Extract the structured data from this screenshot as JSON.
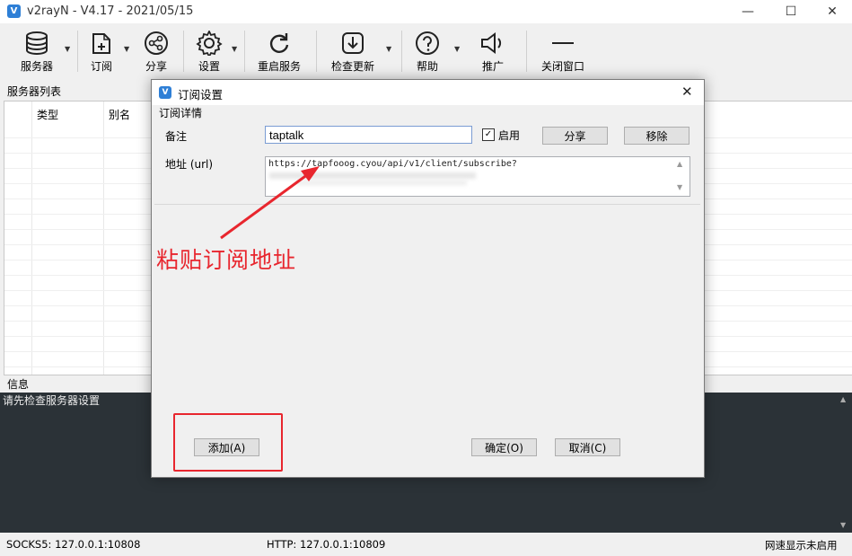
{
  "window": {
    "title": "v2rayN - V4.17 - 2021/05/15"
  },
  "toolbar": {
    "items": [
      {
        "label": "服务器",
        "icon": "server-database-icon"
      },
      {
        "label": "订阅",
        "icon": "subscription-icon"
      },
      {
        "label": "分享",
        "icon": "share-icon"
      },
      {
        "label": "设置",
        "icon": "gear-icon"
      },
      {
        "label": "重启服务",
        "icon": "restart-icon"
      },
      {
        "label": "检查更新",
        "icon": "download-update-icon"
      },
      {
        "label": "帮助",
        "icon": "help-icon"
      },
      {
        "label": "推广",
        "icon": "speaker-icon"
      },
      {
        "label": "关闭窗口",
        "icon": "minimize-line-icon"
      }
    ]
  },
  "server_list": {
    "title": "服务器列表",
    "columns": [
      "类型",
      "别名"
    ]
  },
  "info": {
    "title": "信息",
    "text": "请先检查服务器设置"
  },
  "status_bar": {
    "socks": "SOCKS5:  127.0.0.1:10808",
    "http": "HTTP:  127.0.0.1:10809",
    "speed": "网速显示未启用"
  },
  "dialog": {
    "title": "订阅设置",
    "group_title": "订阅详情",
    "remark_label": "备注",
    "remark_value": "taptalk",
    "enable_label": "启用",
    "enabled": true,
    "share_button": "分享",
    "remove_button": "移除",
    "url_label": "地址 (url)",
    "url_value": "https://tapfooog.cyou/api/v1/client/subscribe?",
    "add_button": "添加(A)",
    "ok_button": "确定(O)",
    "cancel_button": "取消(C)"
  },
  "annotation": {
    "text": "粘贴订阅地址",
    "color": "#e8262e"
  }
}
